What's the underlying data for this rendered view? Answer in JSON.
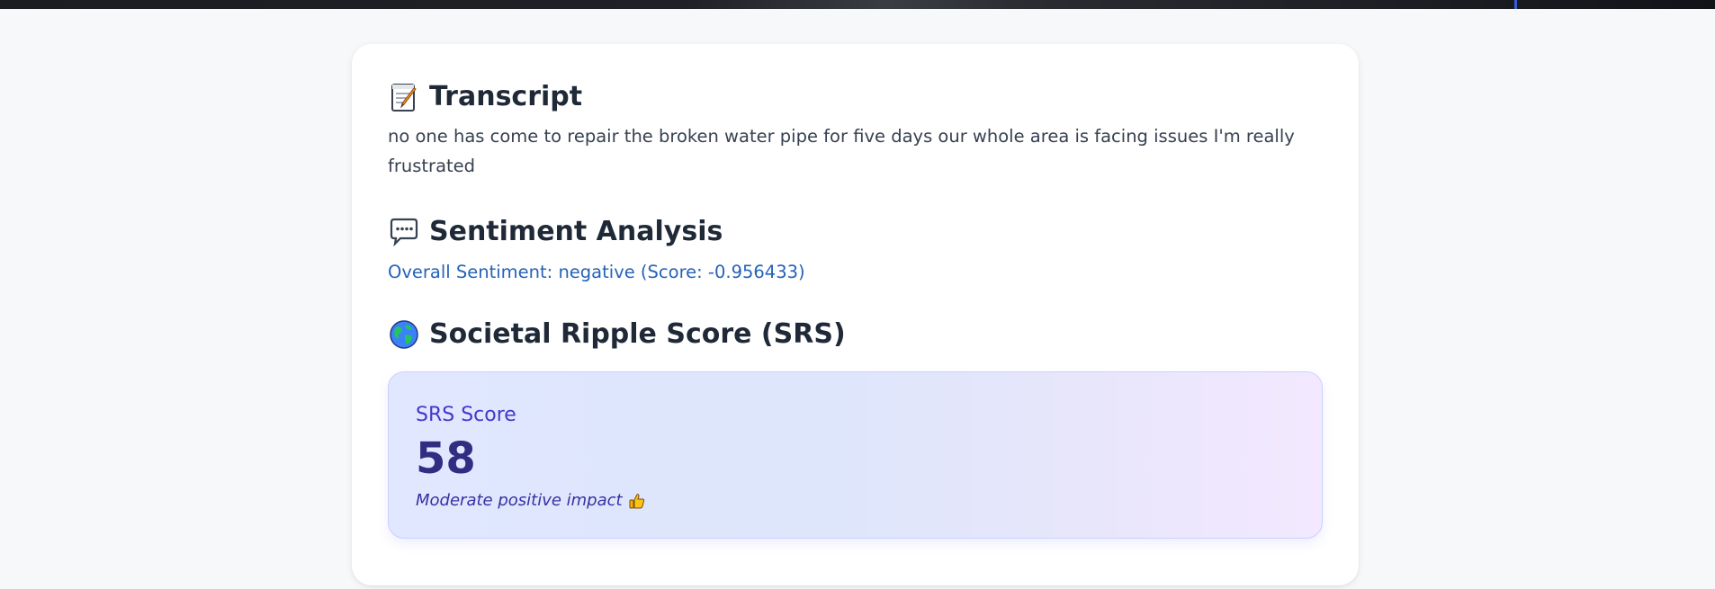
{
  "transcript": {
    "icon": "memo-icon",
    "title": "Transcript",
    "text": "no one has come to repair the broken water pipe for five days our whole area is facing issues I'm really frustrated"
  },
  "sentiment": {
    "icon": "speech-bubble-icon",
    "title": "Sentiment Analysis",
    "overall_line": "Overall Sentiment: negative (Score: -0.956433)"
  },
  "srs": {
    "icon": "globe-icon",
    "title": "Societal Ripple Score (SRS)",
    "score_label": "SRS Score",
    "score_value": "58",
    "impact_text": "Moderate positive impact",
    "impact_icon": "thumbs-up-icon"
  },
  "colors": {
    "page_bg": "#f7f8fa",
    "card_bg": "#ffffff",
    "heading": "#1f2937",
    "sentiment_text": "#2563b8",
    "srs_accent": "#4338ca",
    "srs_value": "#312e81"
  }
}
